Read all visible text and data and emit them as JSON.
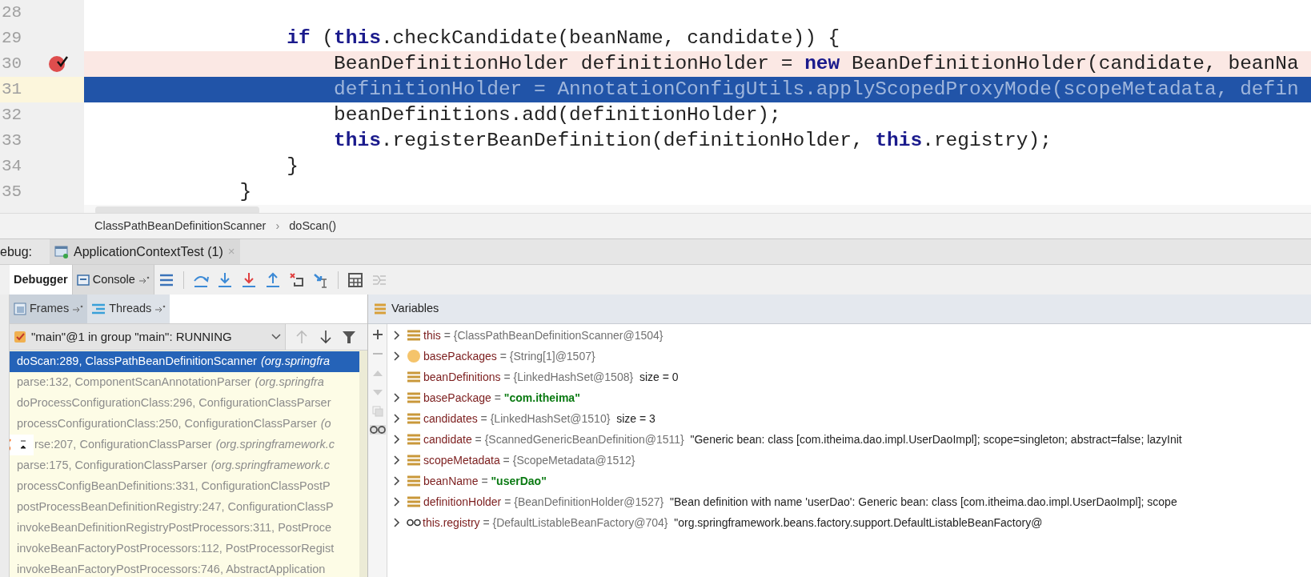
{
  "editor": {
    "lines": [
      {
        "number": "28",
        "breakpoint": false,
        "current": false
      },
      {
        "number": "29",
        "breakpoint": false,
        "current": false,
        "tokens": [
          {
            "text": "                if",
            "kind": "keyword"
          },
          {
            "text": " (",
            "kind": "plain"
          },
          {
            "text": "this",
            "kind": "keyword"
          },
          {
            "text": ".checkCandidate(beanName, candidate)) {",
            "kind": "plain"
          }
        ]
      },
      {
        "number": "30",
        "breakpoint": true,
        "current": false,
        "tokens": [
          {
            "text": "                    BeanDefinitionHolder definitionHolder = ",
            "kind": "plain"
          },
          {
            "text": "new",
            "kind": "keyword"
          },
          {
            "text": " BeanDefinitionHolder(candidate, beanNa",
            "kind": "plain"
          }
        ]
      },
      {
        "number": "31",
        "breakpoint": false,
        "current": true,
        "tokens": [
          {
            "text": "                    definitionHolder = AnnotationConfigUtils.applyScopedProxyMode(scopeMetadata, defin",
            "kind": "plain"
          }
        ]
      },
      {
        "number": "32",
        "breakpoint": false,
        "current": false,
        "tokens": [
          {
            "text": "                    beanDefinitions.add(definitionHolder);",
            "kind": "plain"
          }
        ]
      },
      {
        "number": "33",
        "breakpoint": false,
        "current": false,
        "tokens": [
          {
            "text": "                    this",
            "kind": "keyword"
          },
          {
            "text": ".registerBeanDefinition(definitionHolder, ",
            "kind": "plain"
          },
          {
            "text": "this",
            "kind": "keyword"
          },
          {
            "text": ".registry);",
            "kind": "plain"
          }
        ]
      },
      {
        "number": "34",
        "breakpoint": false,
        "current": false,
        "tokens": [
          {
            "text": "                }",
            "kind": "plain"
          }
        ]
      },
      {
        "number": "35",
        "breakpoint": false,
        "current": false,
        "tokens": [
          {
            "text": "            }",
            "kind": "plain"
          }
        ]
      }
    ]
  },
  "breadcrumb": [
    "ClassPathBeanDefinitionScanner",
    "doScan()"
  ],
  "breadcrumb_separator": "›",
  "debug_bar": {
    "label": "ebug:",
    "session_tab": "ApplicationContextTest (1)",
    "close": "×"
  },
  "toolbar": {
    "tabs": [
      {
        "label": "Debugger",
        "selected": true,
        "kind": "plain"
      },
      {
        "label": "Console",
        "selected": false,
        "kind": "console"
      }
    ]
  },
  "frames_panel": {
    "tabs": [
      {
        "label": "Frames",
        "selected": true,
        "kind": "frames"
      },
      {
        "label": "Threads",
        "selected": false,
        "kind": "threads"
      }
    ],
    "thread": "\"main\"@1 in group \"main\": RUNNING",
    "frames": [
      {
        "location": "doScan:289, ClassPathBeanDefinitionScanner",
        "package": "(org.springfra",
        "selected": true,
        "covered": false
      },
      {
        "location": "parse:132, ComponentScanAnnotationParser",
        "package": "(org.springfra",
        "selected": false,
        "covered": false
      },
      {
        "location": "doProcessConfigurationClass:296, ConfigurationClassParser",
        "selected": false,
        "covered": false
      },
      {
        "location": "processConfigurationClass:250, ConfigurationClassParser",
        "package": "(o",
        "selected": false,
        "covered": false
      },
      {
        "location": "rse:207, ConfigurationClassParser",
        "package": "(org.springframework.c",
        "selected": false,
        "covered": true
      },
      {
        "location": "parse:175, ConfigurationClassParser",
        "package": "(org.springframework.c",
        "selected": false,
        "covered": false
      },
      {
        "location": "processConfigBeanDefinitions:331, ConfigurationClassPostP",
        "selected": false,
        "covered": false
      },
      {
        "location": "postProcessBeanDefinitionRegistry:247, ConfigurationClassP",
        "selected": false,
        "covered": false
      },
      {
        "location": "invokeBeanDefinitionRegistryPostProcessors:311, PostProce",
        "selected": false,
        "covered": false
      },
      {
        "location": "invokeBeanFactoryPostProcessors:112, PostProcessorRegist",
        "selected": false,
        "covered": false
      },
      {
        "location": "invokeBeanFactoryPostProcessors:746, AbstractApplication",
        "selected": false,
        "covered": false
      }
    ]
  },
  "variables": {
    "title": "Variables",
    "items": [
      {
        "kind": "field",
        "expandable": true,
        "name": "this",
        "op": "=",
        "value": "{ClassPathBeanDefinitionScanner@1504}"
      },
      {
        "kind": "parameter",
        "expandable": true,
        "name": "basePackages",
        "op": "=",
        "value": "{String[1]@1507}"
      },
      {
        "kind": "field",
        "expandable": false,
        "name": "beanDefinitions",
        "op": "=",
        "value": "{LinkedHashSet@1508}",
        "extra": "size = 0"
      },
      {
        "kind": "field",
        "expandable": true,
        "name": "basePackage",
        "op": "=",
        "string": "\"com.itheima\""
      },
      {
        "kind": "field",
        "expandable": true,
        "name": "candidates",
        "op": "=",
        "value": "{LinkedHashSet@1510}",
        "extra": "size = 3"
      },
      {
        "kind": "field",
        "expandable": true,
        "name": "candidate",
        "op": "=",
        "value": "{ScannedGenericBeanDefinition@1511}",
        "extra": "\"Generic bean: class [com.itheima.dao.impl.UserDaoImpl]; scope=singleton; abstract=false; lazyInit"
      },
      {
        "kind": "field",
        "expandable": true,
        "name": "scopeMetadata",
        "op": "=",
        "value": "{ScopeMetadata@1512}"
      },
      {
        "kind": "field",
        "expandable": true,
        "name": "beanName",
        "op": "=",
        "string": "\"userDao\""
      },
      {
        "kind": "field",
        "expandable": true,
        "name": "definitionHolder",
        "op": "=",
        "value": "{BeanDefinitionHolder@1527}",
        "extra": "\"Bean definition with name 'userDao': Generic bean: class [com.itheima.dao.impl.UserDaoImpl]; scope"
      },
      {
        "kind": "watch",
        "expandable": true,
        "name": "this.registry",
        "op": "=",
        "value": "{DefaultListableBeanFactory@704}",
        "extra": "\"org.springframework.beans.factory.support.DefaultListableBeanFactory@"
      }
    ]
  }
}
